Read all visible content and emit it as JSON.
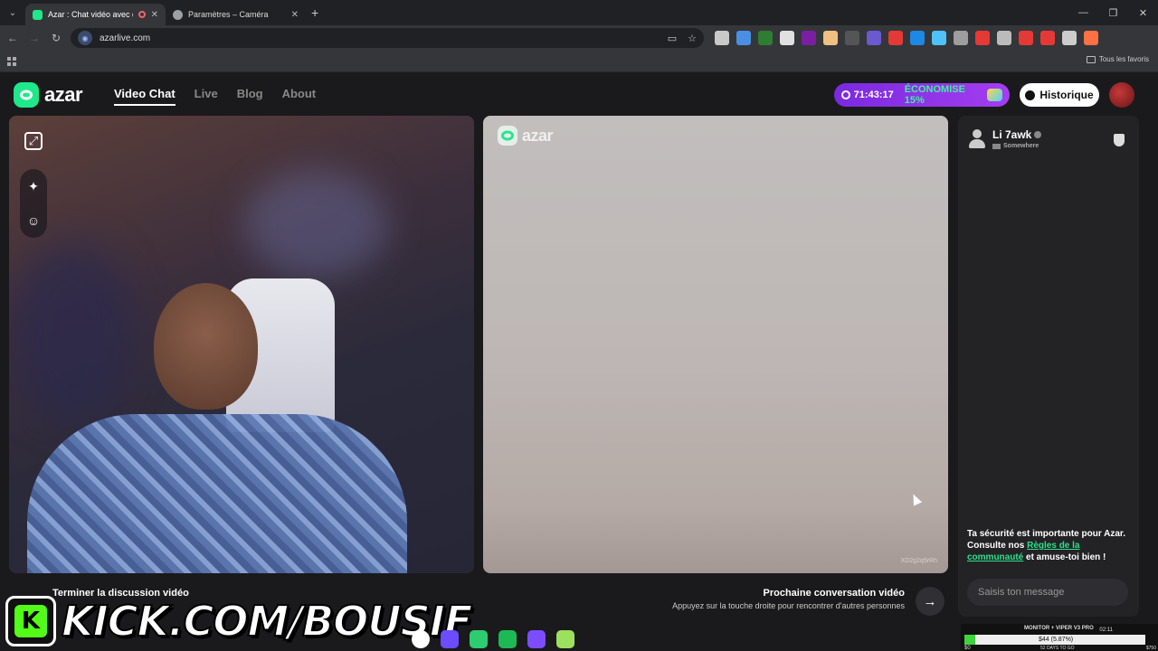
{
  "browser": {
    "tabs": [
      {
        "title": "Azar : Chat vidéo avec de n",
        "active": true,
        "favicon_color": "#1ee88a"
      },
      {
        "title": "Paramètres – Caméra",
        "active": false,
        "favicon_color": "#9aa0a6"
      }
    ],
    "url": "azarlive.com",
    "bookmarks_label": "Tous les favoris",
    "extension_colors": [
      "#c9c9c9",
      "#4a90e2",
      "#2e7d32",
      "#e0e0e0",
      "#7b1fa2",
      "#f0c080",
      "#555",
      "#6a5acd",
      "#e53935",
      "#1e88e5",
      "#4fc3f7",
      "#9e9e9e",
      "#e53935",
      "#bbb",
      "#e53935",
      "#e53935",
      "#ccc",
      "#ff7043"
    ]
  },
  "header": {
    "logo": "azar",
    "nav": [
      {
        "label": "Video Chat",
        "active": true
      },
      {
        "label": "Live",
        "active": false
      },
      {
        "label": "Blog",
        "active": false
      },
      {
        "label": "About",
        "active": false
      }
    ],
    "promo_timer": "71:43:17",
    "promo_text": "ÉCONOMISE 15%",
    "history_label": "Historique"
  },
  "partner_video": {
    "watermark": "azar",
    "id_text": "XD2g2q5rRh"
  },
  "chat": {
    "username": "Li 7awk",
    "location": "Somewhere",
    "safety_text_1": "Ta sécurité est importante pour Azar. Consulte nos ",
    "safety_link": "Règles de la communauté",
    "safety_text_2": " et amuse-toi bien !",
    "input_placeholder": "Saisis ton message"
  },
  "controls": {
    "end_label": "Terminer la discussion vidéo",
    "next_title": "Prochaine conversation vidéo",
    "next_sub": "Appuyez sur la touche droite pour rencontrer d'autres personnes"
  },
  "overlay": {
    "kick_letter": "K",
    "kick_text": "KICK.COM/BOUSIF"
  },
  "monitor": {
    "title": "MONITOR + VIPER V3 PRO",
    "time": "02:11",
    "bar_text": "$44 (5.87%)",
    "progress": 0.0587,
    "low": "$0",
    "days": "52 DAYS TO GO",
    "high": "$750"
  },
  "taskbar_colors": [
    "#ffffff",
    "#6b4cff",
    "#2ecc71",
    "#1db954",
    "#7c4dff",
    "#9be15d"
  ]
}
